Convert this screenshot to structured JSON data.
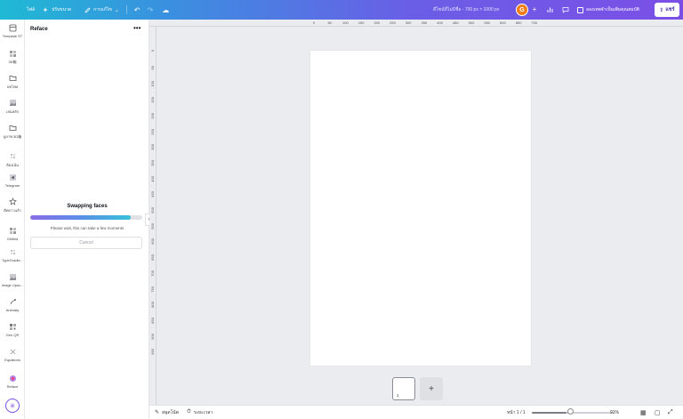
{
  "topbar": {
    "home": "ไฟล์",
    "resize": "ปรับขนาด",
    "edit": "การแก้ไข",
    "doc_title": "ดีไซน์ที่ไม่มีชื่อ - 700 px × 1000 px",
    "avatar_letter": "G",
    "upgrade": "ลองเทพจำเป็นเพิ่มคุณสมบัติ",
    "share": "แชร์",
    "gradient_colors": [
      "#1fb9d4",
      "#7b4fe6"
    ]
  },
  "rail": {
    "items": [
      {
        "label": "Template ST",
        "icon": "template-icon"
      },
      {
        "label": "3D箱",
        "icon": "grid-icon"
      },
      {
        "label": "บทโฟล",
        "icon": "folder-icon"
      },
      {
        "label": "เล่นหลัก",
        "icon": "image-icon"
      },
      {
        "label": "ดูภาพ 3D箱",
        "icon": "folder-icon"
      },
      {
        "label": "ต้องเน้น",
        "icon": "dots-icon"
      },
      {
        "label": "Telegram",
        "icon": "telegram-icon"
      },
      {
        "label": "ติดดาวแล้ว",
        "icon": "star-icon"
      },
      {
        "label": "Ghiblid",
        "icon": "grid-icon"
      },
      {
        "label": "TypeGradie...",
        "icon": "dots-icon"
      },
      {
        "label": "Image Upsc...",
        "icon": "image-icon"
      },
      {
        "label": "Animaty",
        "icon": "animate-icon"
      },
      {
        "label": "Gen QR",
        "icon": "qr-icon"
      },
      {
        "label": "Equations",
        "icon": "equation-icon"
      },
      {
        "label": "Reface",
        "icon": "reface-icon"
      }
    ]
  },
  "panel": {
    "title": "Reface",
    "more": "•••",
    "swap_title": "Swapping faces",
    "progress": 0.9,
    "wait_text": "Please wait, this can take a few moments",
    "cancel": "Cancel"
  },
  "ruler": {
    "top": [
      "0",
      "50",
      "100",
      "150",
      "200",
      "250",
      "300",
      "350",
      "400",
      "450",
      "500",
      "550",
      "600",
      "650",
      "700"
    ],
    "left": [
      "0",
      "50",
      "100",
      "150",
      "200",
      "250",
      "300",
      "350",
      "400",
      "450",
      "500",
      "550",
      "600",
      "650",
      "700",
      "750",
      "800",
      "850",
      "900",
      "950"
    ]
  },
  "pages": {
    "thumb_number": "1",
    "add": "+"
  },
  "bottombar": {
    "notes": "สมุดโน้ต",
    "timer": "ระยะเวลา",
    "page_indicator": "หน้า 1 / 1",
    "zoom": "91%",
    "zoom_level": 0.42
  }
}
